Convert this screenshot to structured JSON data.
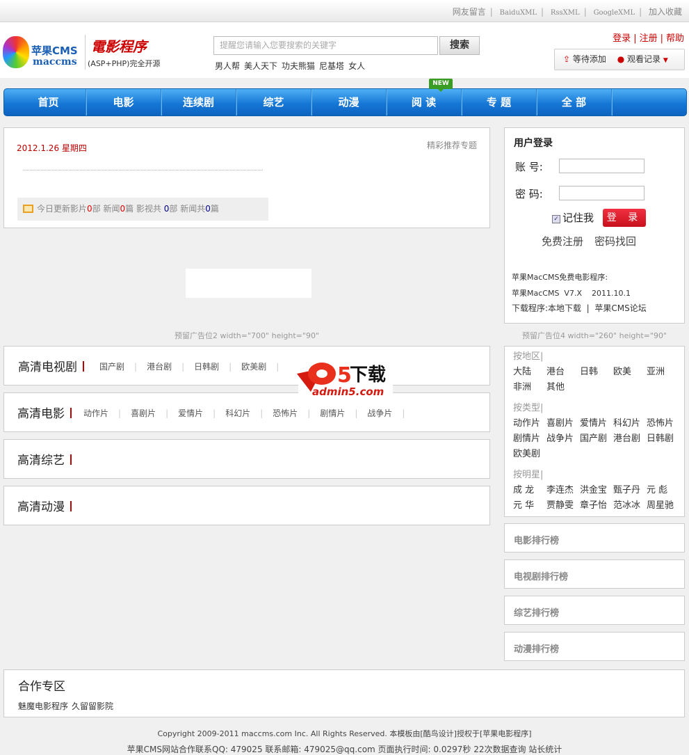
{
  "topbar": {
    "links": [
      "网友留言",
      "BaiduXML",
      "RssXML",
      "GoogleXML",
      "加入收藏"
    ]
  },
  "logo": {
    "cn": "苹果CMS",
    "en": "maccms",
    "slogan": "電影程序",
    "sub": "(ASP+PHP)完全开源"
  },
  "search": {
    "placeholder": "提醒您请输入您要搜索的关键字",
    "button": "搜索",
    "hot": [
      "男人帮",
      "美人天下",
      "功夫熊猫",
      "尼基塔",
      "女人"
    ]
  },
  "user_links": [
    "登录",
    "注册",
    "帮助"
  ],
  "history": {
    "add": "等待添加",
    "watch": "观看记录"
  },
  "nav": {
    "items": [
      "首页",
      "电影",
      "连续剧",
      "综艺",
      "动漫",
      "阅 读",
      "专 题",
      "全 部"
    ],
    "badge": "NEW"
  },
  "info": {
    "date": "2012.1.26",
    "weekday": "星期四",
    "featured": "精彩推荐专题",
    "stats": {
      "p1": "今日更新影片",
      "v1": "0",
      "p2": "部 新闻",
      "v2": "0",
      "p3": "篇 影视共 ",
      "v3": "0",
      "p4": "部 新闻共",
      "v4": "0",
      "p5": "篇"
    }
  },
  "ads": {
    "ad2": "预留广告位2 width=\"700\" height=\"90\"",
    "ad4": "预留广告位4 width=\"260\" height=\"90\""
  },
  "sections": [
    {
      "title": "高清电视剧",
      "links": [
        "国产剧",
        "港台剧",
        "日韩剧",
        "欧美剧"
      ]
    },
    {
      "title": "高清电影",
      "links": [
        "动作片",
        "喜剧片",
        "爱情片",
        "科幻片",
        "恐怖片",
        "剧情片",
        "战争片"
      ]
    },
    {
      "title": "高清综艺",
      "links": []
    },
    {
      "title": "高清动漫",
      "links": []
    }
  ],
  "watermark": {
    "brand": "a5下载",
    "url": "admin5.com"
  },
  "login": {
    "title": "用户登录",
    "account": "账 号:",
    "password": "密 码:",
    "remember": "记住我",
    "submit": "登 录",
    "register": "免费注册",
    "recover": "密码找回",
    "info1": "苹果MacCMS免费电影程序:",
    "info2": "苹果MacCMS  V7.X    2011.10.1",
    "info3a": "下载程序:本地下载",
    "info3b": "苹果CMS论坛"
  },
  "categories": {
    "region_title": "按地区|",
    "regions": [
      "大陆",
      "港台",
      "日韩",
      "欧美",
      "亚洲",
      "非洲",
      "其他"
    ],
    "type_title": "按类型|",
    "types": [
      "动作片",
      "喜剧片",
      "爱情片",
      "科幻片",
      "恐怖片",
      "剧情片",
      "战争片",
      "国产剧",
      "港台剧",
      "日韩剧",
      "欧美剧"
    ],
    "star_title": "按明星|",
    "stars": [
      "成 龙",
      "李连杰",
      "洪金宝",
      "甄子丹",
      "元 彪",
      "元 华",
      "贾静雯",
      "章子怡",
      "范冰冰",
      "周星驰"
    ]
  },
  "rankings": [
    "电影排行榜",
    "电视剧排行榜",
    "综艺排行榜",
    "动漫排行榜"
  ],
  "partner": {
    "title": "合作专区",
    "links": [
      "魅魔电影程序",
      "久留留影院"
    ]
  },
  "footer": {
    "line1": "Copyright 2009-2011 maccms.com Inc. All Rights Reserved. 本模板由[酷鸟设计]授权于[苹果电影程序]",
    "line2": "苹果CMS网站合作联系QQ: 479025 联系邮箱: 479025@qq.com 页面执行时间: 0.0297秒 22次数据查询 站长统计"
  }
}
